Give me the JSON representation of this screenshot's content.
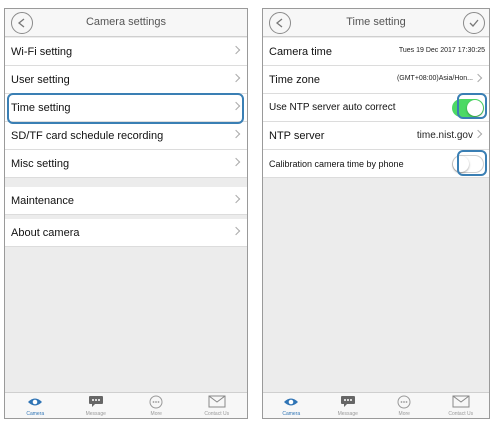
{
  "left": {
    "title": "Camera settings",
    "items": [
      {
        "label": "Wi-Fi setting"
      },
      {
        "label": "User setting"
      },
      {
        "label": "Time setting"
      },
      {
        "label": "SD/TF card schedule recording"
      },
      {
        "label": "Misc setting"
      },
      {
        "label": "Maintenance"
      },
      {
        "label": "About camera"
      }
    ],
    "tabs": [
      {
        "label": "Camera",
        "icon": "eye-icon"
      },
      {
        "label": "Message",
        "icon": "chat-bubble-icon"
      },
      {
        "label": "More",
        "icon": "more-dots-icon"
      },
      {
        "label": "Contact Us",
        "icon": "envelope-icon"
      }
    ]
  },
  "right": {
    "title": "Time setting",
    "rows": {
      "camera_time": {
        "label": "Camera time",
        "value": "Tues 19 Dec 2017  17:30:25"
      },
      "time_zone": {
        "label": "Time zone",
        "value": "(GMT+08:00)Asia/Hon..."
      },
      "ntp_auto": {
        "label": "Use NTP server auto correct",
        "on": true
      },
      "ntp_server": {
        "label": "NTP server",
        "value": "time.nist.gov"
      },
      "calibration": {
        "label": "Calibration camera time by phone",
        "on": false
      }
    },
    "tabs": [
      {
        "label": "Camera",
        "icon": "eye-icon"
      },
      {
        "label": "Message",
        "icon": "chat-bubble-icon"
      },
      {
        "label": "More",
        "icon": "more-dots-icon"
      },
      {
        "label": "Contact Us",
        "icon": "envelope-icon"
      }
    ]
  },
  "colors": {
    "accent": "#2f74b5",
    "highlight": "#3a7fb4",
    "toggle_on": "#4cd964"
  }
}
